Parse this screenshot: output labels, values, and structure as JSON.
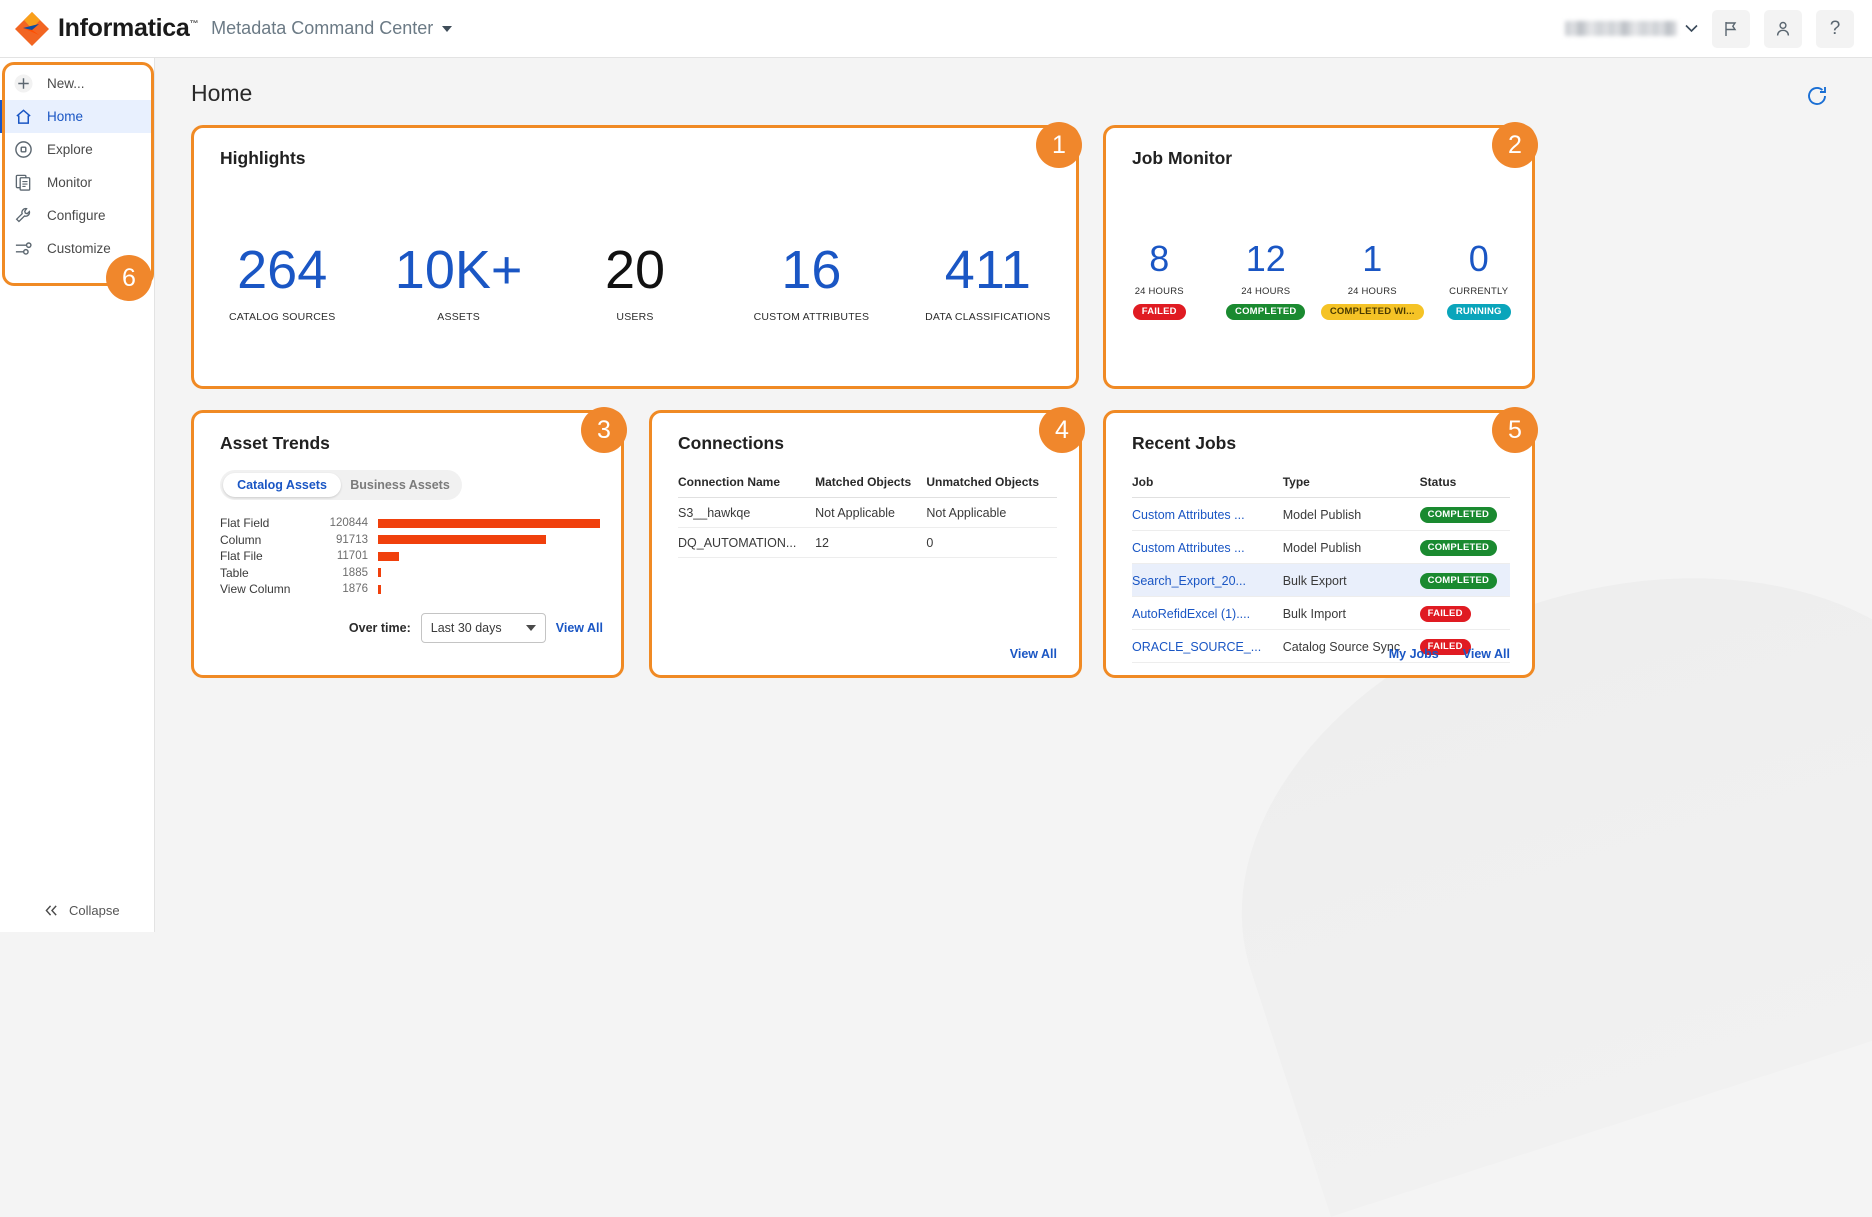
{
  "header": {
    "brand": "Informatica",
    "trademark": "™",
    "app_name": "Metadata Command Center",
    "icons": {
      "app_caret": "chevron-down-icon",
      "user_caret": "chevron-down-icon",
      "flag": "flag-icon",
      "account": "user-icon",
      "help": "?"
    }
  },
  "sidebar": {
    "items": [
      {
        "label": "New...",
        "icon": "plus-icon",
        "active": false
      },
      {
        "label": "Home",
        "icon": "home-icon",
        "active": true
      },
      {
        "label": "Explore",
        "icon": "compass-icon",
        "active": false
      },
      {
        "label": "Monitor",
        "icon": "documents-icon",
        "active": false
      },
      {
        "label": "Configure",
        "icon": "wrench-icon",
        "active": false
      },
      {
        "label": "Customize",
        "icon": "sliders-icon",
        "active": false
      }
    ],
    "collapse_label": "Collapse",
    "badge": "6"
  },
  "main": {
    "page_title": "Home",
    "refresh_icon": "refresh-icon"
  },
  "highlights": {
    "title": "Highlights",
    "badge": "1",
    "metrics": [
      {
        "value": "264",
        "label": "CATALOG SOURCES",
        "dark": false
      },
      {
        "value": "10K+",
        "label": "ASSETS",
        "dark": false
      },
      {
        "value": "20",
        "label": "USERS",
        "dark": true
      },
      {
        "value": "16",
        "label": "CUSTOM ATTRIBUTES",
        "dark": false
      },
      {
        "value": "411",
        "label": "DATA CLASSIFICATIONS",
        "dark": false
      }
    ]
  },
  "job_monitor": {
    "title": "Job Monitor",
    "badge": "2",
    "metrics": [
      {
        "value": "8",
        "period": "24 HOURS",
        "status": "FAILED",
        "color": "#e01b22"
      },
      {
        "value": "12",
        "period": "24 HOURS",
        "status": "COMPLETED",
        "color": "#1a8a30"
      },
      {
        "value": "1",
        "period": "24 HOURS",
        "status": "COMPLETED WI...",
        "color": "#f5c326"
      },
      {
        "value": "0",
        "period": "CURRENTLY",
        "status": "RUNNING",
        "color": "#0aa5bb"
      }
    ]
  },
  "asset_trends": {
    "title": "Asset Trends",
    "badge": "3",
    "tabs": [
      {
        "label": "Catalog Assets",
        "active": true
      },
      {
        "label": "Business Assets",
        "active": false
      }
    ],
    "over_time_label": "Over time:",
    "over_time_value": "Last 30 days",
    "view_all": "View All",
    "chart_data": {
      "type": "bar",
      "title": "Asset Trends",
      "orientation": "horizontal",
      "categories": [
        "Flat Field",
        "Column",
        "Flat File",
        "Table",
        "View Column"
      ],
      "values": [
        120844,
        91713,
        11701,
        1885,
        1876
      ],
      "value_labels": [
        "120844",
        "91713",
        "11701",
        "1885",
        "1876"
      ],
      "bar_color": "#f0400c",
      "xlabel": "",
      "ylabel": "",
      "xlim": [
        0,
        120844
      ],
      "grid": false,
      "legend": false
    }
  },
  "connections": {
    "title": "Connections",
    "badge": "4",
    "columns": [
      "Connection Name",
      "Matched Objects",
      "Unmatched Objects"
    ],
    "rows": [
      [
        "S3__hawkqe",
        "Not Applicable",
        "Not Applicable"
      ],
      [
        "DQ_AUTOMATION...",
        "12",
        "0"
      ]
    ],
    "view_all": "View All"
  },
  "recent_jobs": {
    "title": "Recent Jobs",
    "badge": "5",
    "columns": [
      "Job",
      "Type",
      "Status"
    ],
    "rows": [
      {
        "job": "Custom Attributes ...",
        "type": "Model Publish",
        "status": "COMPLETED",
        "color": "#1a8a30",
        "highlight": false
      },
      {
        "job": "Custom Attributes ...",
        "type": "Model Publish",
        "status": "COMPLETED",
        "color": "#1a8a30",
        "highlight": false
      },
      {
        "job": "Search_Export_20...",
        "type": "Bulk Export",
        "status": "COMPLETED",
        "color": "#1a8a30",
        "highlight": true
      },
      {
        "job": "AutoRefidExcel (1)....",
        "type": "Bulk Import",
        "status": "FAILED",
        "color": "#e01b22",
        "highlight": false
      },
      {
        "job": "ORACLE_SOURCE_...",
        "type": "Catalog Source Sync",
        "status": "FAILED",
        "color": "#e01b22",
        "highlight": false
      }
    ],
    "my_jobs": "My Jobs",
    "view_all": "View All"
  },
  "colors": {
    "accent_orange": "#f0872c",
    "link_blue": "#1a56c4",
    "bar_orange": "#f0400c"
  }
}
